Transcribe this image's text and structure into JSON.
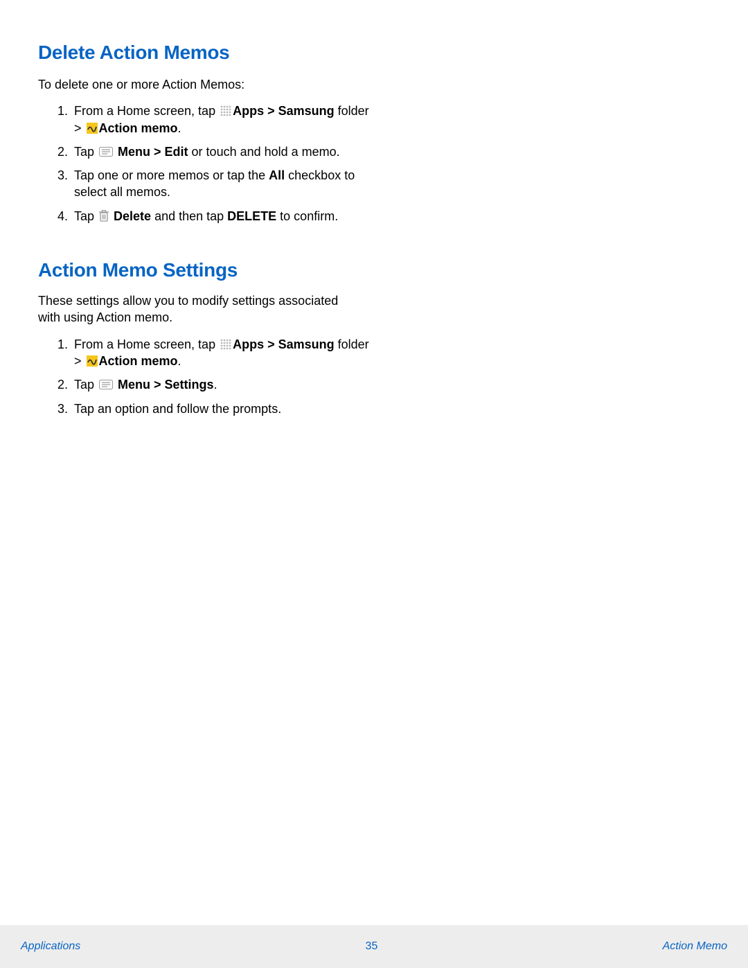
{
  "section1": {
    "heading": "Delete Action Memos",
    "intro": "To delete one or more Action Memos:",
    "step1_a": "From a Home screen, tap ",
    "step1_b": "Apps > Samsung",
    "step1_c": " folder > ",
    "step1_d": "Action memo",
    "step1_e": ".",
    "step2_a": "Tap ",
    "step2_b": " Menu > Edit",
    "step2_c": " or touch and hold a memo.",
    "step3_a": "Tap one or more memos or tap the ",
    "step3_b": "All",
    "step3_c": " checkbox to select all memos.",
    "step4_a": "Tap ",
    "step4_b": " Delete",
    "step4_c": " and then tap ",
    "step4_d": "DELETE",
    "step4_e": " to confirm."
  },
  "section2": {
    "heading": "Action Memo Settings",
    "intro": "These settings allow you to modify settings associated with using Action memo.",
    "step1_a": "From a Home screen, tap ",
    "step1_b": "Apps > Samsung",
    "step1_c": " folder > ",
    "step1_d": "Action memo",
    "step1_e": ".",
    "step2_a": "Tap ",
    "step2_b": " Menu > Settings",
    "step2_c": ".",
    "step3": "Tap an option and follow the prompts."
  },
  "footer": {
    "left": "Applications",
    "center": "35",
    "right": "Action Memo"
  }
}
